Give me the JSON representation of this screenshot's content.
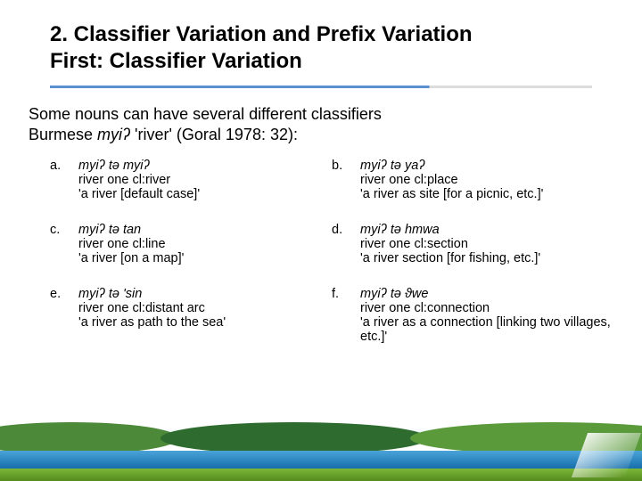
{
  "header": {
    "line1": "2. Classifier Variation and Prefix Variation",
    "line2": "First: Classifier Variation"
  },
  "intro": {
    "line1": "Some nouns can have several different classifiers",
    "line2_pre": "Burmese ",
    "line2_word": "myiʔ",
    "line2_post": " 'river' (Goral 1978: 32):"
  },
  "examples": [
    {
      "label": "a.",
      "words": "myiʔ tǝ     myiʔ",
      "gloss": "river one  cl:river",
      "trans": "'a river [default case]'"
    },
    {
      "label": "b.",
      "words": "myiʔ tǝ     yaʔ",
      "gloss": "river one  cl:place",
      "trans": "'a river as site [for a picnic, etc.]'"
    },
    {
      "label": "c.",
      "words": "myiʔ tǝ     tan",
      "gloss": "river one  cl:line",
      "trans": "'a river [on a map]'"
    },
    {
      "label": "d.",
      "words": "myiʔ tǝ     hmwa",
      "gloss": "river one  cl:section",
      "trans": "'a river section [for fishing, etc.]'"
    },
    {
      "label": "e.",
      "words": "myiʔ tǝ     'sin",
      "gloss": "river one  cl:distant arc",
      "trans": "'a river as path to the sea'"
    },
    {
      "label": "f.",
      "words": "myiʔ tǝ     ϑwe",
      "gloss": "river one  cl:connection",
      "trans": "'a river as a connection\n[linking two villages, etc.]'"
    }
  ]
}
